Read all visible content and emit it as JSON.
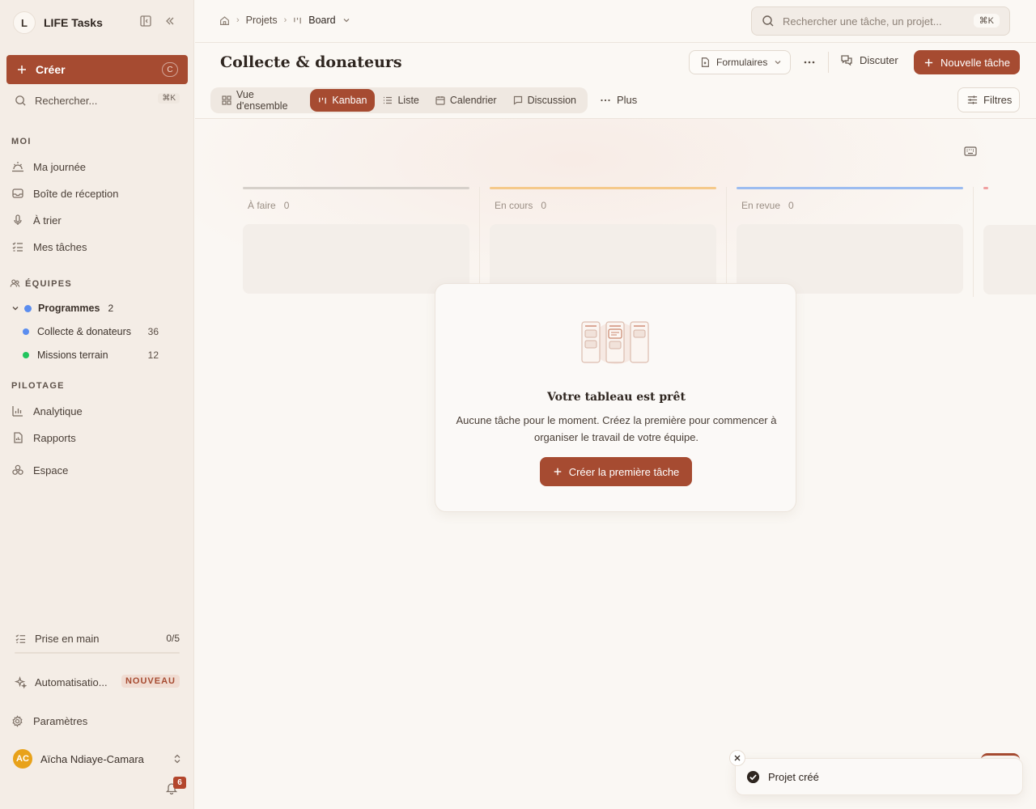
{
  "workspace": {
    "initial": "L",
    "name": "LIFE Tasks"
  },
  "sidebar": {
    "create_label": "Créer",
    "create_shortcut": "C",
    "search_label": "Rechercher...",
    "search_shortcut": "⌘K",
    "section_me": "MOI",
    "me_items": [
      {
        "label": "Ma journée",
        "icon": "sunrise-icon"
      },
      {
        "label": "Boîte de réception",
        "icon": "inbox-icon"
      },
      {
        "label": "À trier",
        "icon": "mic-icon"
      },
      {
        "label": "Mes tâches",
        "icon": "tasks-icon"
      }
    ],
    "section_teams": "ÉQUIPES",
    "team": {
      "name": "Programmes",
      "count": "2",
      "color": "#5b8def"
    },
    "projects": [
      {
        "name": "Collecte & donateurs",
        "count": "36",
        "color": "#5b8def"
      },
      {
        "name": "Missions terrain",
        "count": "12",
        "color": "#22c55e"
      }
    ],
    "section_pilot": "PILOTAGE",
    "pilot_items": [
      {
        "label": "Analytique",
        "icon": "bar-chart-icon"
      },
      {
        "label": "Rapports",
        "icon": "report-icon"
      },
      {
        "label": "Espace",
        "icon": "space-icon"
      }
    ],
    "getting_started": {
      "label": "Prise en main",
      "progress": "0/5"
    },
    "automation": {
      "label": "Automatisatio...",
      "badge": "NOUVEAU"
    },
    "settings_label": "Paramètres",
    "user": {
      "initials": "AC",
      "name": "Aïcha Ndiaye-Camara"
    },
    "notifications": "6"
  },
  "breadcrumb": {
    "projects": "Projets",
    "current": "Board"
  },
  "top_search": {
    "placeholder": "Rechercher une tâche, un projet...",
    "shortcut": "⌘K"
  },
  "project": {
    "title": "Collecte & donateurs",
    "forms_label": "Formulaires",
    "discuss_label": "Discuter",
    "new_task_label": "Nouvelle tâche"
  },
  "tabs": [
    {
      "label": "Vue d'ensemble",
      "icon": "grid-icon",
      "active": false
    },
    {
      "label": "Kanban",
      "icon": "kanban-icon",
      "active": true
    },
    {
      "label": "Liste",
      "icon": "list-icon",
      "active": false
    },
    {
      "label": "Calendrier",
      "icon": "calendar-icon",
      "active": false
    },
    {
      "label": "Discussion",
      "icon": "chat-icon",
      "active": false
    }
  ],
  "more_label": "Plus",
  "filters_label": "Filtres",
  "columns": [
    {
      "title": "À faire",
      "count": "0",
      "color": "#d6d0ca"
    },
    {
      "title": "En cours",
      "count": "0",
      "color": "#f5c98a"
    },
    {
      "title": "En revue",
      "count": "0",
      "color": "#9cbcf0"
    }
  ],
  "empty_state": {
    "title": "Votre tableau est prêt",
    "description": "Aucune tâche pour le moment. Créez la première pour commencer à organiser le travail de votre équipe.",
    "button": "Créer la première tâche"
  },
  "toast": {
    "message": "Projet créé"
  }
}
